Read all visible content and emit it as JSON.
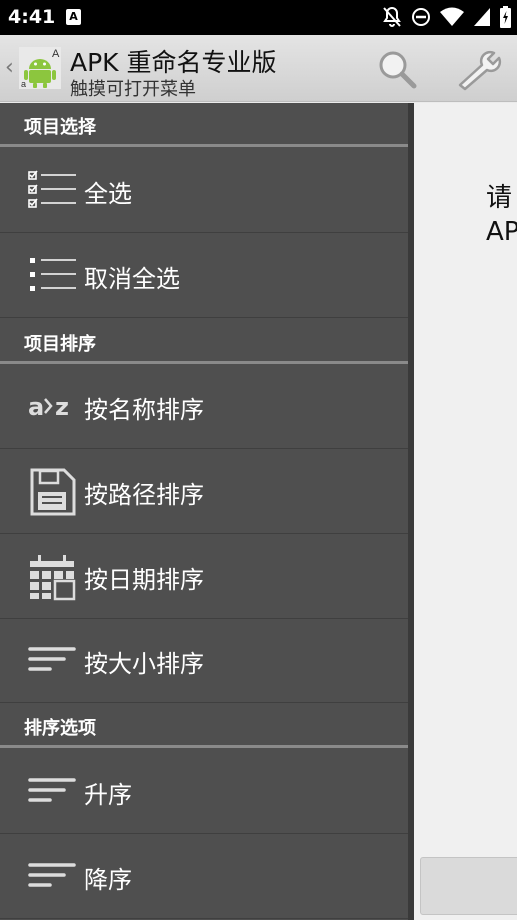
{
  "status_bar": {
    "time": "4:41",
    "notification_badge": "A",
    "icons": [
      "notifications-off-icon",
      "do-not-disturb-icon",
      "wifi-icon",
      "cellular-signal-icon",
      "battery-charging-icon"
    ]
  },
  "action_bar": {
    "title": "APK 重命名专业版",
    "subtitle": "触摸可打开菜单",
    "icons": [
      "app-icon",
      "search-icon",
      "wrench-icon"
    ]
  },
  "drawer": {
    "sections": [
      {
        "header": "项目选择",
        "items": [
          {
            "label": "全选",
            "icon": "select-all-icon"
          },
          {
            "label": "取消全选",
            "icon": "deselect-all-icon"
          }
        ]
      },
      {
        "header": "项目排序",
        "items": [
          {
            "label": "按名称排序",
            "icon": "sort-alpha-icon"
          },
          {
            "label": "按路径排序",
            "icon": "save-icon"
          },
          {
            "label": "按日期排序",
            "icon": "calendar-icon"
          },
          {
            "label": "按大小排序",
            "icon": "sort-lines-icon"
          }
        ]
      },
      {
        "header": "排序选项",
        "items": [
          {
            "label": "升序",
            "icon": "sort-lines-icon"
          },
          {
            "label": "降序",
            "icon": "sort-lines-icon"
          }
        ]
      }
    ]
  },
  "content": {
    "message": "请\nAP"
  },
  "colors": {
    "drawer_bg": "#4f4f4f",
    "action_bar_bg": "#dcdcdc",
    "section_divider": "#8a8a8a",
    "android_green": "#8cc63e"
  }
}
